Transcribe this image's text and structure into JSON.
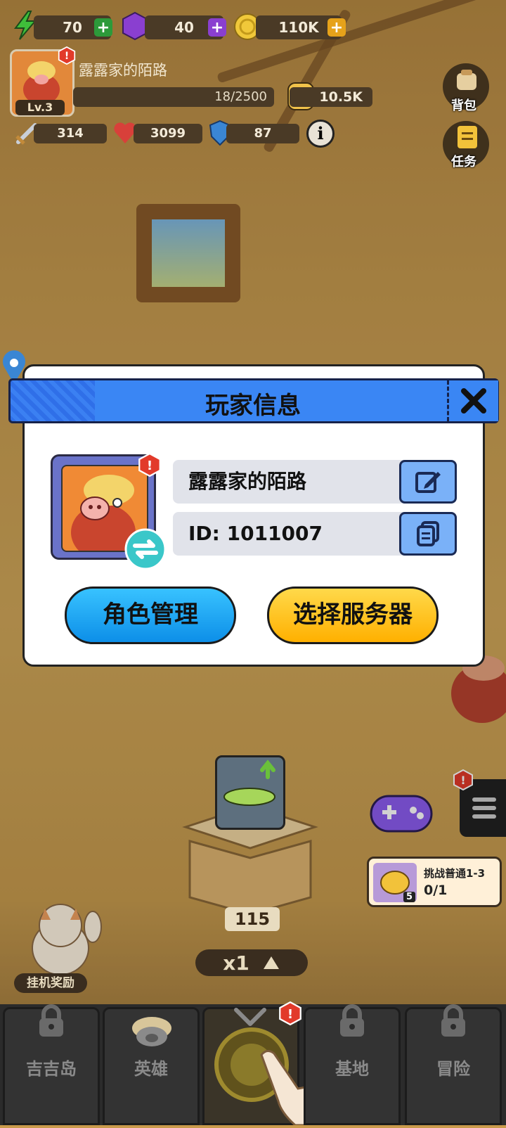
{
  "hud": {
    "energy": "70",
    "gems": "40",
    "coins": "110K",
    "player_name": "露露家的陌路",
    "level": "Lv.3",
    "xp": "18/2500",
    "power": "10.5K",
    "attack": "314",
    "hp": "3099",
    "defense": "87",
    "backpack_label": "背包",
    "tasks_label": "任务"
  },
  "dialog": {
    "title": "玩家信息",
    "name_value": "露露家的陌路",
    "id_value": "ID: 1011007",
    "role_button": "角色管理",
    "server_button": "选择服务器"
  },
  "scene": {
    "chest_count": "115",
    "speed": "x1",
    "challenge_title": "挑战普通1-3",
    "challenge_progress": "0/1",
    "challenge_badge": "5",
    "idle_reward": "挂机奖励"
  },
  "nav": {
    "tabs": [
      "吉吉岛",
      "英雄",
      "",
      "基地",
      "冒险"
    ]
  },
  "colors": {
    "dialog_header": "#3a86f4",
    "role_button": "#1aa6f0",
    "server_button": "#ffc21a",
    "alert_badge": "#e23a2a"
  }
}
